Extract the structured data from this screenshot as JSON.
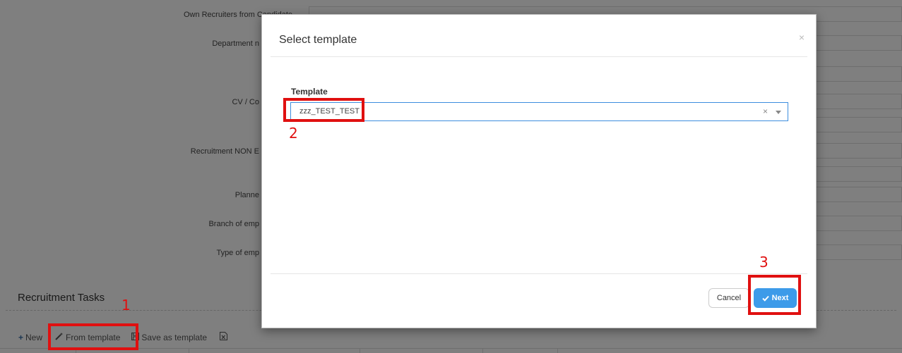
{
  "background_form": {
    "labels": [
      "Own Recruiters from Candidate",
      "Department n",
      "CV / Co",
      "Recruitment NON E",
      "Planne",
      "Branch of emp",
      "Type of emp"
    ],
    "section_title": "Recruitment Tasks",
    "toolbar": {
      "new_label": "New",
      "from_template_label": "From template",
      "save_as_template_label": "Save as template"
    }
  },
  "modal": {
    "title": "Select template",
    "close_glyph": "×",
    "field_label": "Template",
    "select_value": "zzz_TEST_TEST",
    "clear_glyph": "×",
    "cancel_label": "Cancel",
    "next_label": "Next"
  },
  "annotations": {
    "step1": "1",
    "step2": "2",
    "step3": "3"
  },
  "colors": {
    "primary": "#3d9be9",
    "focus_border": "#3c8dde",
    "annotation": "#e01010"
  }
}
